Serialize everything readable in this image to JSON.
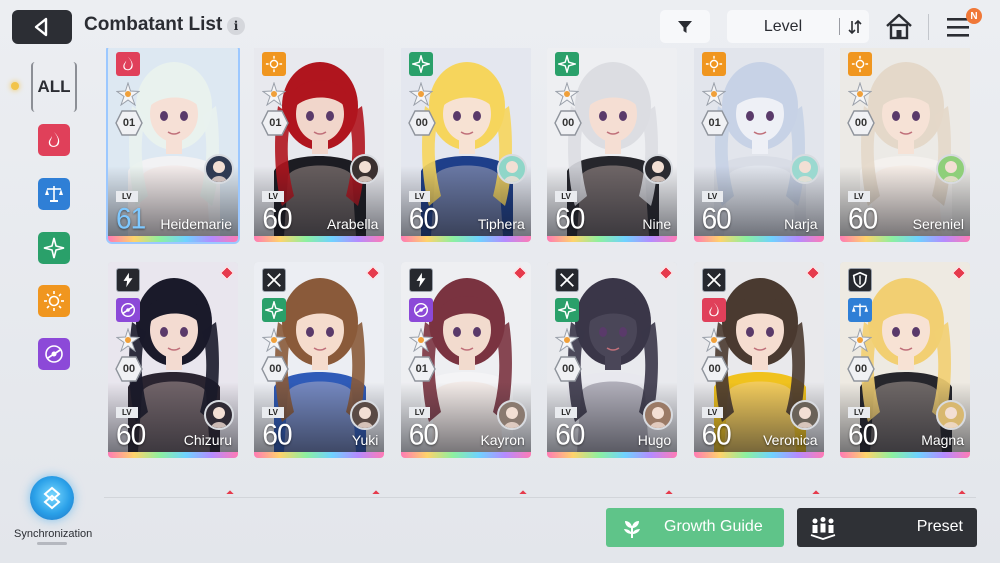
{
  "header": {
    "title": "Combatant List",
    "info_glyph": "i",
    "sort_label": "Level",
    "notification_badge": "N"
  },
  "sidebar": {
    "all_label": "ALL",
    "filters": [
      {
        "name": "fire",
        "color": "#e0405a"
      },
      {
        "name": "order",
        "color": "#2f7fd6"
      },
      {
        "name": "wind",
        "color": "#2aa06a"
      },
      {
        "name": "light",
        "color": "#f0961f"
      },
      {
        "name": "void",
        "color": "#8c49d8"
      }
    ],
    "sync_label": "Synchronization"
  },
  "combatants": [
    {
      "name": "Heidemarie",
      "level": "61",
      "rank": "01",
      "element": "fire",
      "selected": true,
      "hair": "#e9f2ee",
      "skin": "#f6e0d6",
      "outfit": "#f2f2f4",
      "bg": "#dde8f2",
      "avatar": "#2f3a52"
    },
    {
      "name": "Arabella",
      "level": "60",
      "rank": "01",
      "element": "light",
      "hair": "#b0151e",
      "skin": "#f1d6cb",
      "outfit": "#1c1c22",
      "bg": "#e8e9ee",
      "avatar": "#3a3030"
    },
    {
      "name": "Tiphera",
      "level": "60",
      "rank": "00",
      "element": "wind",
      "hair": "#f6d55c",
      "skin": "#f7e2d3",
      "outfit": "#1e3f8a",
      "bg": "#e4e7ef",
      "avatar": "#8fd6c8"
    },
    {
      "name": "Nine",
      "level": "60",
      "rank": "00",
      "element": "wind",
      "hair": "#dcdde2",
      "skin": "#f5ded3",
      "outfit": "#26262c",
      "bg": "#eeeff2",
      "avatar": "#2a2a30"
    },
    {
      "name": "Narja",
      "level": "60",
      "rank": "01",
      "element": "light",
      "hair": "#c7d2e6",
      "skin": "#eef0f6",
      "outfit": "#d9dde6",
      "bg": "#e2e5ec",
      "avatar": "#9bd9d0"
    },
    {
      "name": "Sereniel",
      "level": "60",
      "rank": "00",
      "element": "light",
      "hair": "#e4d8c9",
      "skin": "#f6e2d6",
      "outfit": "#f4f1ee",
      "bg": "#eceae6",
      "avatar": "#8fcf7a"
    },
    {
      "name": "Chizuru",
      "level": "60",
      "rank": "00",
      "element": "void",
      "class": "lightning",
      "diamond": true,
      "hair": "#1a1a2a",
      "skin": "#f3dbd1",
      "outfit": "#2a2430",
      "bg": "#e9e6ee",
      "avatar": "#2f2a34"
    },
    {
      "name": "Yuki",
      "level": "60",
      "rank": "00",
      "element": "wind",
      "class": "swords",
      "diamond": true,
      "hair": "#8a5a3a",
      "skin": "#f5dccd",
      "outfit": "#2f5bb8",
      "bg": "#eceef3",
      "avatar": "#5a4a44"
    },
    {
      "name": "Kayron",
      "level": "60",
      "rank": "01",
      "element": "void",
      "class": "lightning",
      "diamond": true,
      "hair": "#7a3340",
      "skin": "#f2dbce",
      "outfit": "#f4f4f6",
      "bg": "#eeeff2",
      "avatar": "#8a7a70"
    },
    {
      "name": "Hugo",
      "level": "60",
      "rank": "00",
      "element": "wind",
      "class": "swords",
      "diamond": true,
      "hair": "#3a3648",
      "skin": "#4a4658",
      "outfit": "#e8e8ee",
      "bg": "#e9eaee",
      "avatar": "#9a7a66"
    },
    {
      "name": "Veronica",
      "level": "60",
      "rank": "00",
      "element": "fire",
      "class": "swords",
      "diamond": true,
      "hair": "#4a3a30",
      "skin": "#f5ddd0",
      "outfit": "#f0c21e",
      "bg": "#e9e9ec",
      "avatar": "#6a6258"
    },
    {
      "name": "Magna",
      "level": "60",
      "rank": "00",
      "element": "order",
      "class": "shield",
      "diamond": true,
      "hair": "#f2cf72",
      "skin": "#f7e2d4",
      "outfit": "#26262c",
      "bg": "#eeeae2",
      "avatar": "#d8b870"
    }
  ],
  "buttons": {
    "growth_guide": "Growth Guide",
    "preset": "Preset"
  }
}
